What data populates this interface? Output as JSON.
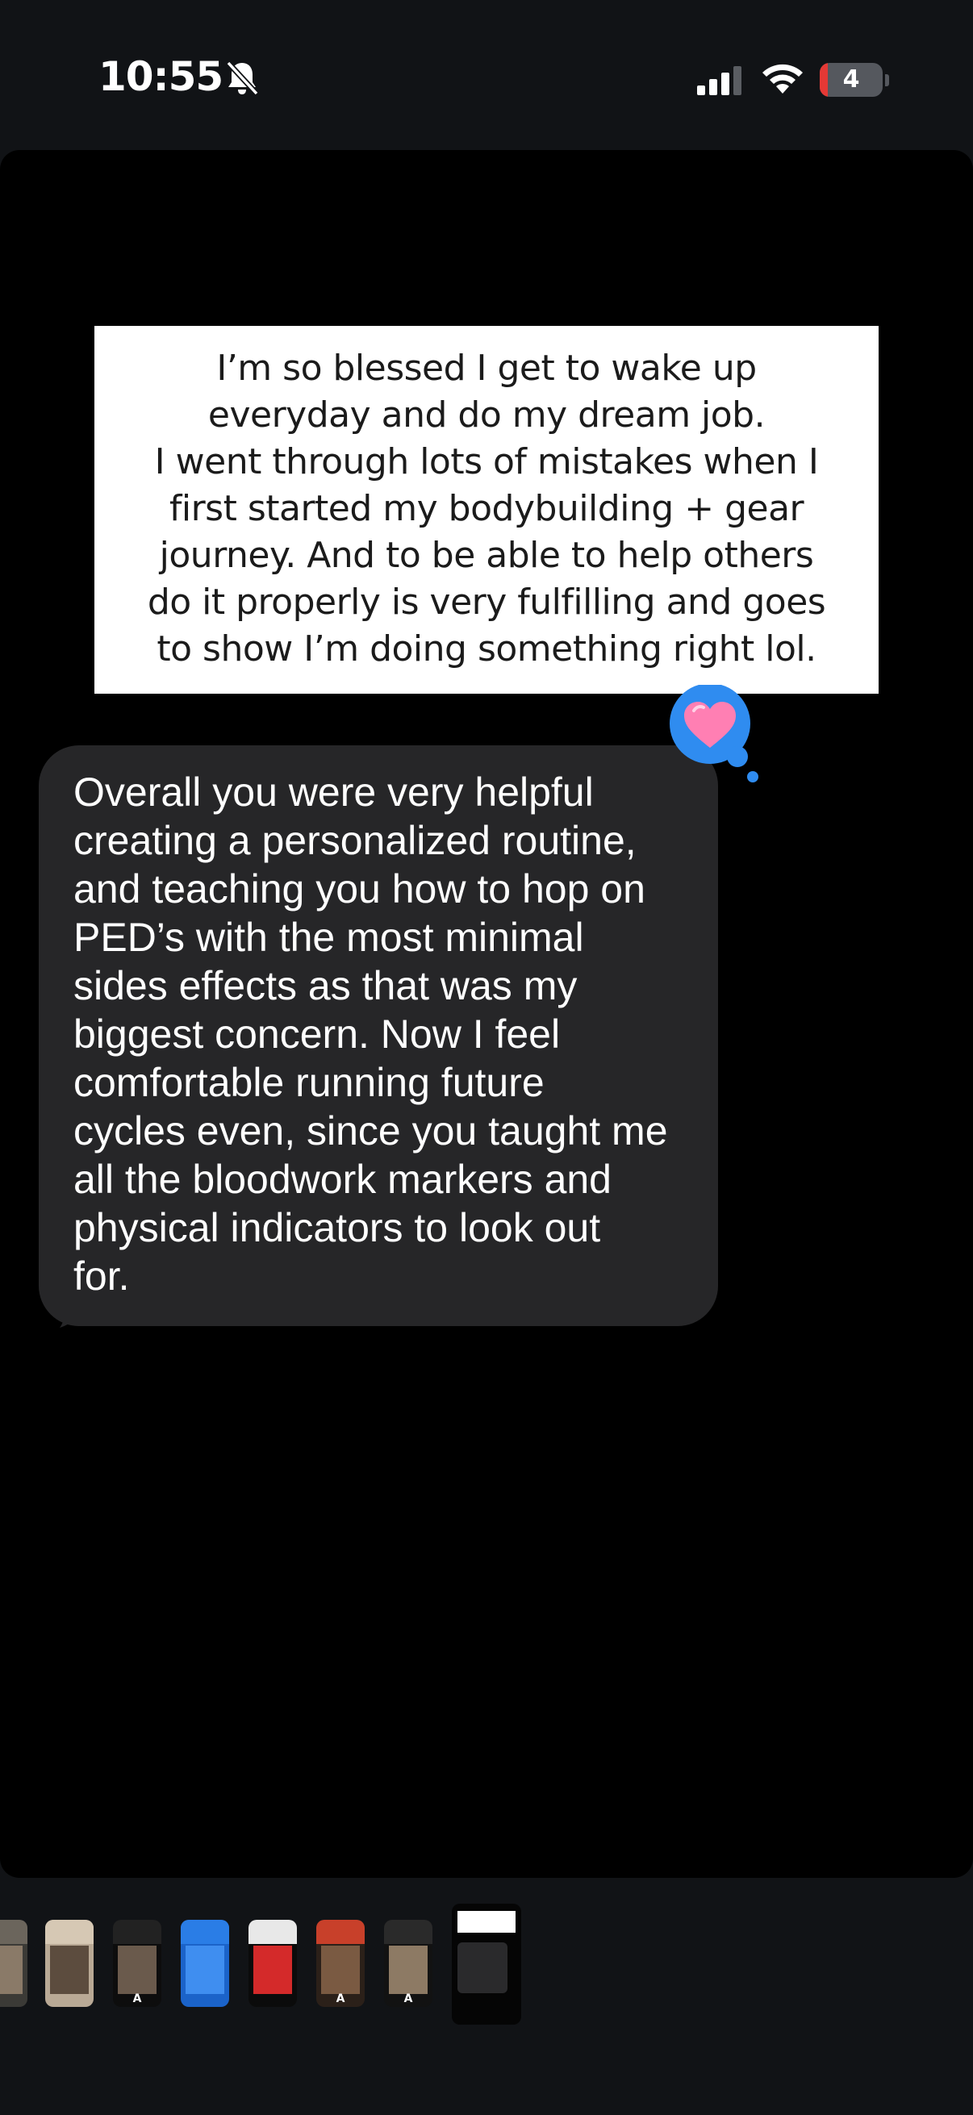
{
  "status_bar": {
    "time": "10:55",
    "battery_level": "4",
    "battery_fraction": 0.04,
    "icons": [
      "bell-slash-icon",
      "cellular-signal-icon",
      "wifi-icon",
      "battery-icon"
    ]
  },
  "story": {
    "quote_lines": [
      "I’m so blessed I get to wake up",
      "everyday and do my dream job.",
      "I went through lots of mistakes when I",
      "first started my bodybuilding + gear",
      "journey. And to be able to help others",
      "do it properly is very fulfilling and goes",
      "to show I’m doing something right lol."
    ],
    "reaction_icon": "pink-heart-icon",
    "message_lines": [
      "Overall you were very helpful",
      "creating a personalized routine,",
      "and teaching you how to hop on",
      "PED’s with the most minimal",
      "sides effects as that was my",
      "biggest concern. Now I feel",
      "comfortable running future",
      "cycles even, since you taught me",
      "all the bloodwork markers and",
      "physical indicators to look out",
      "for."
    ]
  },
  "thumbnails": {
    "count": 8,
    "active_index": 7
  },
  "colors": {
    "background": "#111316",
    "story_background": "#000000",
    "bubble": "#262628",
    "reaction_blue": "#2f8cf0",
    "battery_red": "#e53935"
  }
}
